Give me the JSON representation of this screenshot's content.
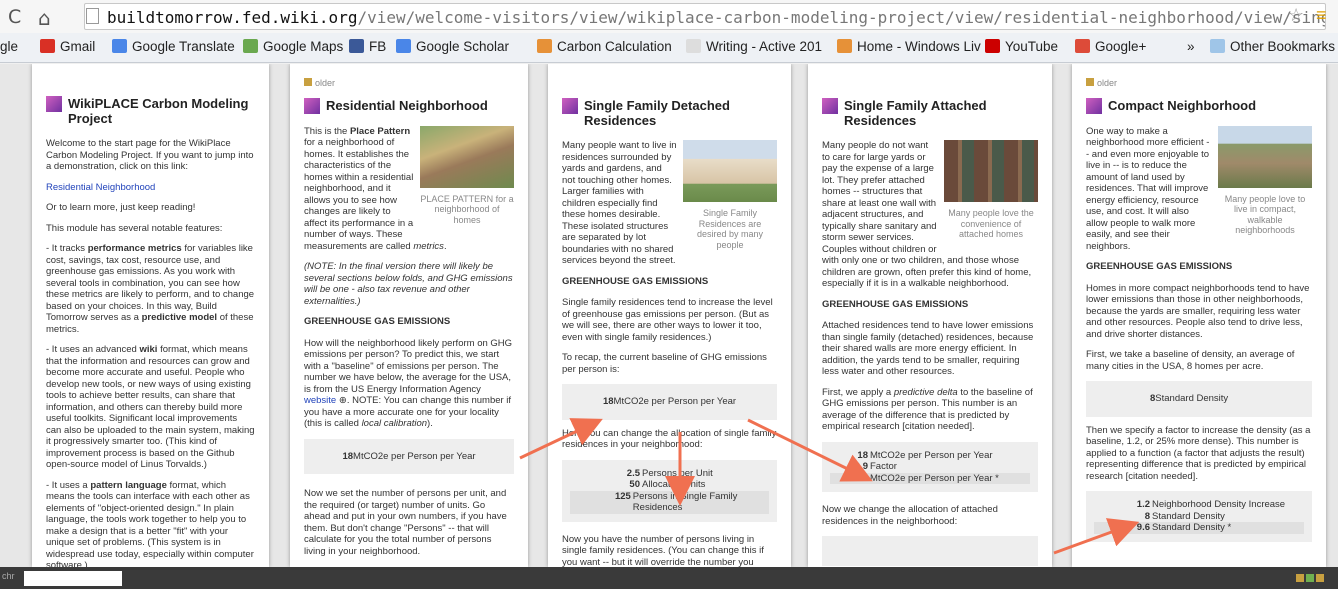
{
  "browser": {
    "url_domain": "buildtomorrow.fed.wiki.org",
    "url_path": "/view/welcome-visitors/view/wikiplace-carbon-modeling-project/view/residential-neighborhood/view/single-family-detached-residences/view/sin...",
    "back_glyph": "C",
    "home_glyph": "⌂",
    "star_glyph": "☆",
    "menu_glyph": "≡"
  },
  "bookmarks": [
    {
      "label": "gle",
      "color": "#ffffff"
    },
    {
      "label": "Gmail",
      "color": "#d93025",
      "prefix": "M"
    },
    {
      "label": "Google Translate",
      "color": "#4a86e8"
    },
    {
      "label": "Google Maps",
      "color": "#6aa84f"
    },
    {
      "label": "FB",
      "color": "#3b5998"
    },
    {
      "label": "Google Scholar",
      "color": "#4a86e8"
    },
    {
      "label": "Carbon Calculation",
      "color": "#e69138"
    },
    {
      "label": "Writing - Active 201",
      "color": "#dddddd"
    },
    {
      "label": "Home - Windows Liv",
      "color": "#e69138"
    },
    {
      "label": "YouTube",
      "color": "#cc0000"
    },
    {
      "label": "Google+",
      "color": "#dd4b39"
    },
    {
      "label": "»",
      "color": ""
    },
    {
      "label": "Other Bookmarks",
      "color": "#9fc5e8"
    }
  ],
  "pages": {
    "p1": {
      "title": "WikiPLACE Carbon Modeling Project",
      "intro": "Welcome to the start page for the WikiPlace Carbon Modeling Project. If you want to jump into a demonstration, click on this link:",
      "link": "Residential Neighborhood",
      "learn": "Or to learn more, just keep reading!",
      "features": "This module has several notable features:",
      "b1a": "- It tracks ",
      "b1b": "performance metrics",
      "b1c": " for variables like cost, savings, tax cost, resource use, and greenhouse gas emissions. As you work with several tools in combination, you can see how these metrics are likely to perform, and to change based on your choices. In this way, Build Tomorrow serves as a ",
      "b1d": "predictive model",
      "b1e": " of these metrics.",
      "b2a": "- It uses an advanced ",
      "b2b": "wiki",
      "b2c": " format, which means that the information and resources can grow and become more accurate and useful. People who develop new tools, or new ways of using existing tools to achieve better results, can share that information, and others can thereby build more useful toolkits. Significant local improvements can also be uploaded to the main system, making it progressively smarter too. (This kind of improvement process is based on the Github open-source model of Linus Torvalds.)",
      "b3a": "- It uses a ",
      "b3b": "pattern language",
      "b3c": " format, which means the tools can interface with each other as elements of \"object-oriented design.\" In plain language, the tools work together to help you to make a design that is a better \"fit\" with your unique set of problems. (This system is in widespread use today, especially within computer software.)"
    },
    "p2": {
      "older": "older",
      "title": "Residential Neighborhood",
      "caption": "PLACE PATTERN for a neighborhood of homes",
      "t1": "This is the ",
      "t1b": "Place Pattern",
      "t1c": " for a neighborhood of homes. It establishes the characteristics of the homes within a residential neighborhood, and it allows you to see how changes are likely to affect its performance in a number of ways. These measurements are called ",
      "t1d": "metrics",
      "note": "(NOTE: In the final version there will likely be several sections below folds, and GHG emissions will be one - also tax revenue and other externalities.)",
      "heading": "GREENHOUSE GAS EMISSIONS",
      "ghg": "How will the neighborhood likely perform on GHG emissions per person? To predict this, we start with a \"baseline\" of emissions per person. The number we have below, the average for the USA, is from the US Energy Information Agency ",
      "ghg_link": "website",
      "ghg2": ". NOTE: You can change this number if you have a more accurate one for your locality (this is called ",
      "ghg3": "local calibration",
      "calc_val": "18",
      "calc_label": "MtCO2e per Person per Year",
      "after": "Now we set the number of persons per unit, and the required (or target) number of units. Go ahead and put in your own numbers, if you have them. But don't change \"Persons\" -- that will calculate for you the total number of persons living in your neighborhood."
    },
    "p3": {
      "title": "Single Family Detached Residences",
      "caption": "Single Family Residences are desired by many people",
      "t1": "Many people want to live in residences surrounded by yards and gardens, and not touching other homes. Larger families with children especially find these homes desirable. These isolated structures are separated by lot boundaries with no shared services beyond the street.",
      "heading": "GREENHOUSE GAS EMISSIONS",
      "ghg": "Single family residences tend to increase the level of greenhouse gas emissions per person. (But as we will see, there are other ways to lower it too, even with single family residences.)",
      "recap": "To recap, the current baseline of GHG emissions per person is:",
      "c1_val": "18",
      "c1_label": "MtCO2e per Person per Year",
      "change": "Here you can change the allocation of single family residences in your neighborhood:",
      "c2": [
        {
          "v": "2.5",
          "l": "Persons per Unit"
        },
        {
          "v": "50",
          "l": "Allocated Units"
        },
        {
          "v": "125",
          "l": "Persons in Single Family Residences"
        }
      ],
      "after": "Now you have the number of persons living in single family residences. (You can change this if you want -- but it will override the number you"
    },
    "p4": {
      "title": "Single Family Attached Residences",
      "caption": "Many people love the convenience of attached homes",
      "t1": "Many people do not want to care for large yards or pay the expense of a large lot. They prefer attached homes -- structures that share at least one wall with adjacent structures, and typically share sanitary and storm sewer services. Couples without children or with only one or two children, and those whose children are grown, often prefer this kind of home, especially if it is in a walkable neighborhood.",
      "heading": "GREENHOUSE GAS EMISSIONS",
      "ghg": "Attached residences tend to have lower emissions than single family (detached) residences, because their shared walls are more energy efficient. In addition, the yards tend to be smaller, requiring less water and other resources.",
      "delta1": "First, we apply a ",
      "delta2": "predictive delta",
      "delta3": " to the baseline of GHG emissions per person. This number is an average of the difference that is predicted by empirical research [citation needed].",
      "c1": [
        {
          "v": "18",
          "l": "MtCO2e per Person per Year"
        },
        {
          "v": "0.9",
          "l": "Factor"
        },
        {
          "v": "16.2",
          "l": "MtCO2e per Person per Year *"
        }
      ],
      "after": "Now we change the allocation of attached residences in the neighborhood:"
    },
    "p5": {
      "older": "older",
      "title": "Compact Neighborhood",
      "caption": "Many people love to live in compact, walkable neighborhoods",
      "t1": "One way to make a neighborhood more efficient -- and even more enjoyable to live in -- is to reduce the amount of land used by residences. That will improve energy efficiency, resource use, and cost. It will also allow people to walk more easily, and see their neighbors.",
      "heading": "GREENHOUSE GAS EMISSIONS",
      "ghg": "Homes in more compact neighborhoods tend to have lower emissions than those in other neighborhoods, because the yards are smaller, requiring less water and other resources. People also tend to drive less, and drive shorter distances.",
      "density": "First, we take a baseline of density, an average of many cities in the USA, 8 homes per acre.",
      "c1_val": "8",
      "c1_label": "Standard Density",
      "factor": "Then we specify a factor to increase the density (as a baseline, 1.2, or 25% more dense). This number is applied to a function (a factor that adjusts the result) representing difference that is predicted by empirical research [citation needed].",
      "c2": [
        {
          "v": "1.2",
          "l": "Neighborhood Density Increase"
        },
        {
          "v": "8",
          "l": "Standard Density"
        },
        {
          "v": "9.6",
          "l": "Standard Density *"
        }
      ]
    }
  },
  "status": {
    "label": "chr"
  },
  "colors": {
    "arrow": "#f07050",
    "fav": "#a040b0"
  }
}
